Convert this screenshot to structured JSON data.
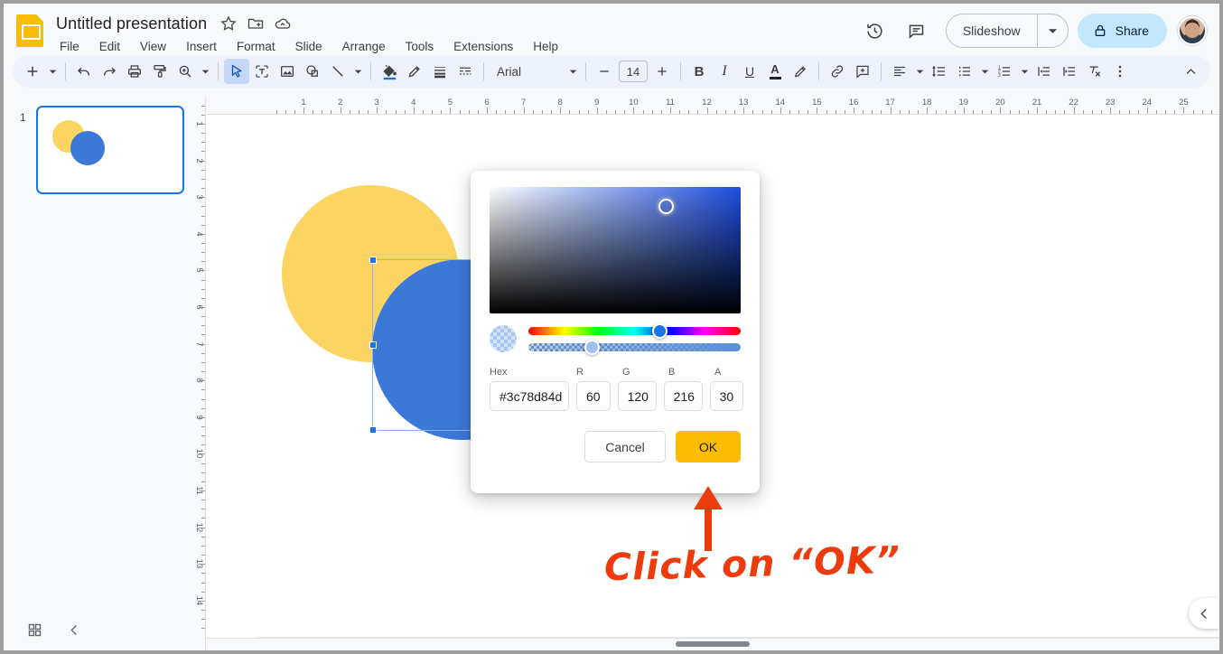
{
  "app": {
    "doc_title": "Untitled presentation",
    "logo_icon": "slides-logo-icon"
  },
  "menu": {
    "items": [
      {
        "label": "File"
      },
      {
        "label": "Edit"
      },
      {
        "label": "View"
      },
      {
        "label": "Insert"
      },
      {
        "label": "Format"
      },
      {
        "label": "Slide"
      },
      {
        "label": "Arrange"
      },
      {
        "label": "Tools"
      },
      {
        "label": "Extensions"
      },
      {
        "label": "Help"
      }
    ]
  },
  "title_actions": {
    "star_icon": "star-icon",
    "move_icon": "move-to-folder-icon",
    "cloud_icon": "cloud-saved-icon"
  },
  "header_right": {
    "history_icon": "version-history-icon",
    "comments_icon": "comments-icon",
    "slideshow_label": "Slideshow",
    "slideshow_caret_icon": "chevron-down-icon",
    "share_label": "Share",
    "share_lock_icon": "lock-icon",
    "avatar": "user-avatar"
  },
  "toolbar": {
    "new_slide_icon": "plus-icon",
    "new_slide_caret_icon": "chevron-down-icon",
    "undo_icon": "undo-icon",
    "redo_icon": "redo-icon",
    "print_icon": "print-icon",
    "paint_format_icon": "paint-format-icon",
    "zoom_icon": "zoom-icon",
    "zoom_caret_icon": "chevron-down-icon",
    "select_icon": "cursor-select-icon",
    "textbox_icon": "text-box-icon",
    "image_icon": "insert-image-icon",
    "shape_icon": "shape-icon",
    "line_icon": "line-icon",
    "line_caret_icon": "chevron-down-icon",
    "fill_color_icon": "fill-color-icon",
    "border_color_icon": "border-color-icon",
    "border_weight_icon": "border-weight-icon",
    "border_dash_icon": "border-dash-icon",
    "font_name": "Arial",
    "font_caret_icon": "chevron-down-icon",
    "font_size_decrease_icon": "minus-icon",
    "font_size": "14",
    "font_size_increase_icon": "plus-icon",
    "bold_label": "B",
    "italic_label": "I",
    "underline_label": "U",
    "text_color_label": "A",
    "highlight_icon": "highlight-icon",
    "link_icon": "insert-link-icon",
    "comment_icon": "add-comment-icon",
    "align_icon": "align-icon",
    "align_caret_icon": "chevron-down-icon",
    "line_spacing_icon": "line-spacing-icon",
    "bulleted_list_icon": "bulleted-list-icon",
    "bulleted_caret_icon": "chevron-down-icon",
    "numbered_list_icon": "numbered-list-icon",
    "numbered_caret_icon": "chevron-down-icon",
    "decrease_indent_icon": "decrease-indent-icon",
    "increase_indent_icon": "increase-indent-icon",
    "clear_format_icon": "clear-formatting-icon",
    "more_icon": "more-options-icon",
    "collapse_icon": "collapse-toolbar-icon"
  },
  "filmstrip": {
    "slide_number": "1",
    "grid_view_icon": "grid-view-icon",
    "collapse_filmstrip_icon": "chevron-left-icon"
  },
  "rulers": {
    "horizontal": [
      "1",
      "2",
      "3",
      "4",
      "5",
      "6",
      "7",
      "8",
      "9",
      "10",
      "11",
      "12",
      "13",
      "14",
      "15",
      "16",
      "17",
      "18",
      "19",
      "20",
      "21",
      "22",
      "23",
      "24",
      "25"
    ],
    "vertical": [
      "1",
      "2",
      "3",
      "4",
      "5",
      "6",
      "7",
      "8",
      "9",
      "10",
      "11",
      "12",
      "13",
      "14"
    ]
  },
  "canvas": {
    "shape_yellow_color": "#fcd462",
    "shape_blue_color": "#3c78d8",
    "selected_shape": "blue-circle",
    "rotate_handle_icon": "rotate-handle"
  },
  "color_dialog": {
    "sv_cursor": "saturation-value-cursor",
    "hue_thumb_pct": "62",
    "alpha_thumb_pct": "30",
    "preview_label": "color-preview-swatch",
    "labels": {
      "hex": "Hex",
      "r": "R",
      "g": "G",
      "b": "B",
      "a": "A"
    },
    "values": {
      "hex": "#3c78d8 4d",
      "hex_value": "#3c78d84d",
      "r": "60",
      "g": "120",
      "b": "216",
      "a": "30"
    },
    "cancel_label": "Cancel",
    "ok_label": "OK",
    "ok_color": "#fbbc04"
  },
  "annotation": {
    "text": "Click on “OK”",
    "color": "#ee3b0e",
    "arrow_icon": "instruction-arrow-up-icon"
  },
  "bottom": {
    "horizontal_scrollbar": "horizontal-scrollbar",
    "right_panel_toggle_icon": "chevron-left-icon"
  }
}
